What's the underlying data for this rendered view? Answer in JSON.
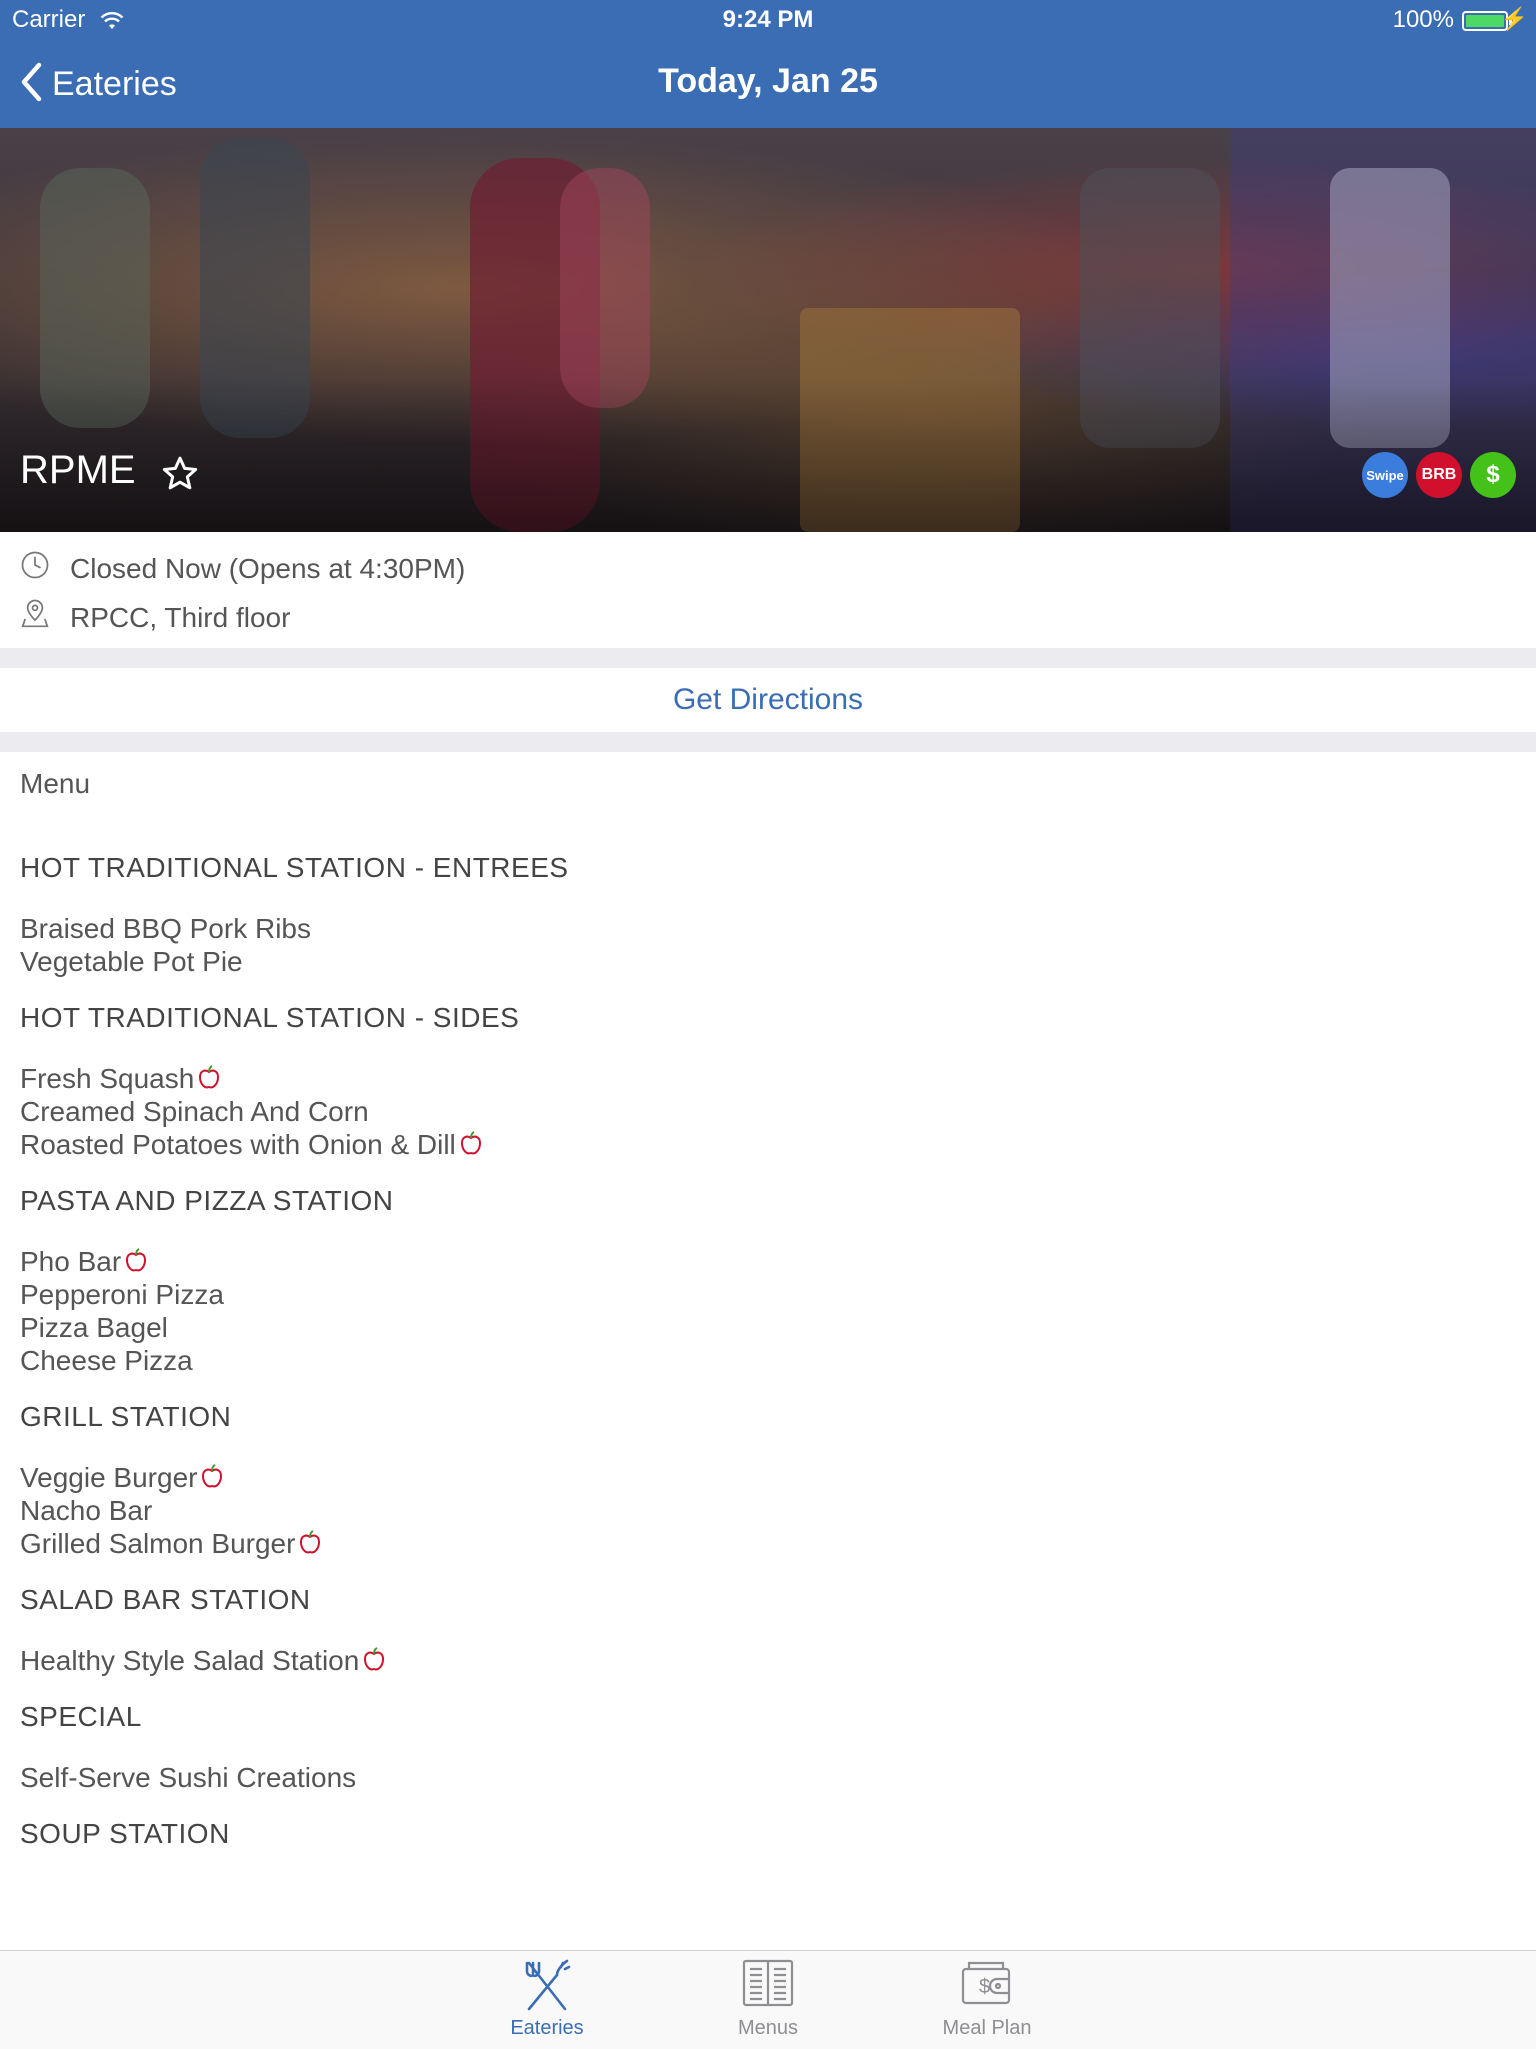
{
  "status_bar": {
    "carrier": "Carrier",
    "time": "9:24 PM",
    "battery": "100%",
    "wifi_icon": "wifi-icon",
    "battery_icon": "battery-icon"
  },
  "nav": {
    "back_label": "Eateries",
    "title": "Today, Jan 25"
  },
  "eatery": {
    "name": "RPME",
    "favorite_icon": "star-outline-icon",
    "payment_badges": [
      {
        "label": "Swipe",
        "color": "#3b7ddd"
      },
      {
        "label": "BRB",
        "color": "#d0102c"
      },
      {
        "label": "$",
        "color": "#44c21a"
      }
    ],
    "status": "Closed Now (Opens at 4:30PM)",
    "location": "RPCC, Third floor",
    "directions_label": "Get Directions"
  },
  "menu": {
    "header": "Menu",
    "stations": [
      {
        "title": "HOT TRADITIONAL STATION - ENTREES",
        "items": [
          {
            "name": "Braised BBQ Pork Ribs",
            "healthy": false
          },
          {
            "name": "Vegetable Pot Pie",
            "healthy": false
          }
        ]
      },
      {
        "title": "HOT TRADITIONAL STATION - SIDES",
        "items": [
          {
            "name": "Fresh Squash",
            "healthy": true
          },
          {
            "name": "Creamed Spinach And Corn",
            "healthy": false
          },
          {
            "name": "Roasted Potatoes with Onion & Dill",
            "healthy": true
          }
        ]
      },
      {
        "title": "PASTA AND PIZZA STATION",
        "items": [
          {
            "name": "Pho Bar",
            "healthy": true
          },
          {
            "name": "Pepperoni Pizza",
            "healthy": false
          },
          {
            "name": "Pizza Bagel",
            "healthy": false
          },
          {
            "name": "Cheese Pizza",
            "healthy": false
          }
        ]
      },
      {
        "title": "GRILL STATION",
        "items": [
          {
            "name": "Veggie Burger",
            "healthy": true
          },
          {
            "name": "Nacho Bar",
            "healthy": false
          },
          {
            "name": "Grilled Salmon Burger",
            "healthy": true
          }
        ]
      },
      {
        "title": "SALAD BAR STATION",
        "items": [
          {
            "name": "Healthy Style Salad Station",
            "healthy": true
          }
        ]
      },
      {
        "title": "SPECIAL",
        "items": [
          {
            "name": "Self-Serve Sushi Creations",
            "healthy": false
          }
        ]
      },
      {
        "title": "SOUP STATION",
        "items": []
      }
    ]
  },
  "tabbar": {
    "tabs": [
      {
        "label": "Eateries",
        "icon": "fork-knife-icon",
        "active": true
      },
      {
        "label": "Menus",
        "icon": "menu-book-icon",
        "active": false
      },
      {
        "label": "Meal Plan",
        "icon": "wallet-icon",
        "active": false
      }
    ]
  },
  "colors": {
    "brand": "#3b6db4",
    "healthy_icon": "#d0102c"
  }
}
